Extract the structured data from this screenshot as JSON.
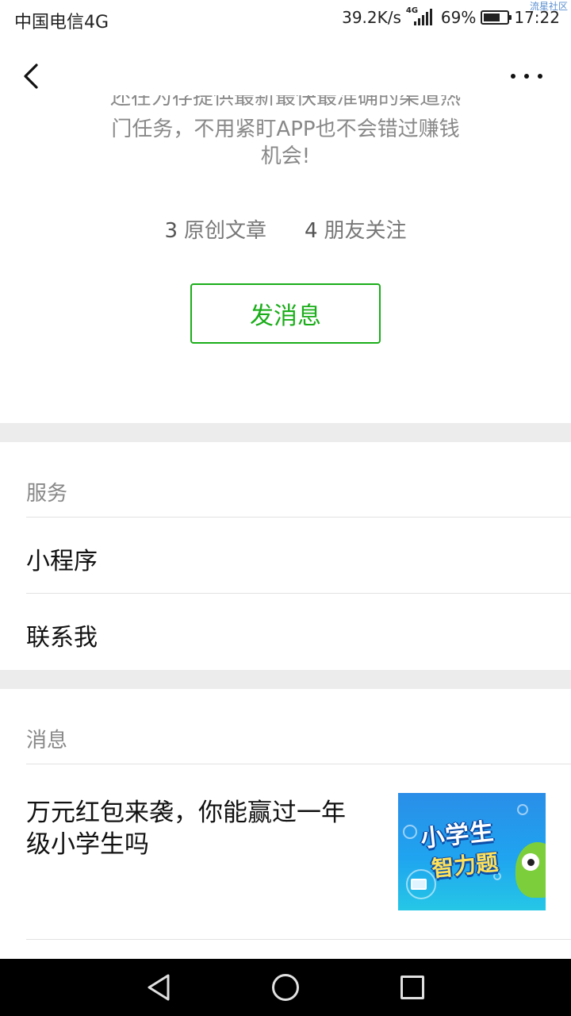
{
  "status_bar": {
    "carrier": "中国电信4G",
    "speed": "39.2K/s",
    "network": "4G",
    "battery": "69%",
    "battery_level": 0.69,
    "time": "17:22",
    "watermark": "流星社区"
  },
  "nav": {
    "back_icon": "chevron-left-icon",
    "more_icon": "more-dots-icon"
  },
  "profile": {
    "desc_cut_line": "还在为存提供最新最快最准确的渠道热",
    "desc_line2": "门任务，不用紧盯APP也不会错过赚钱",
    "desc_line3": "机会!",
    "stats": {
      "articles_count": "3",
      "articles_label": "原创文章",
      "friends_count": "4",
      "friends_label": "朋友关注"
    },
    "message_button": "发消息"
  },
  "services": {
    "title": "服务",
    "items": [
      {
        "label": "小程序"
      },
      {
        "label": "联系我"
      }
    ]
  },
  "messages": {
    "title": "消息",
    "article": {
      "title": "万元红包来袭，你能赢过一年级小学生吗",
      "thumb_text1": "小学生",
      "thumb_text2": "智力题"
    }
  },
  "colors": {
    "accent": "#1aad19",
    "gap": "#ececec",
    "secondary_text": "#888888"
  }
}
